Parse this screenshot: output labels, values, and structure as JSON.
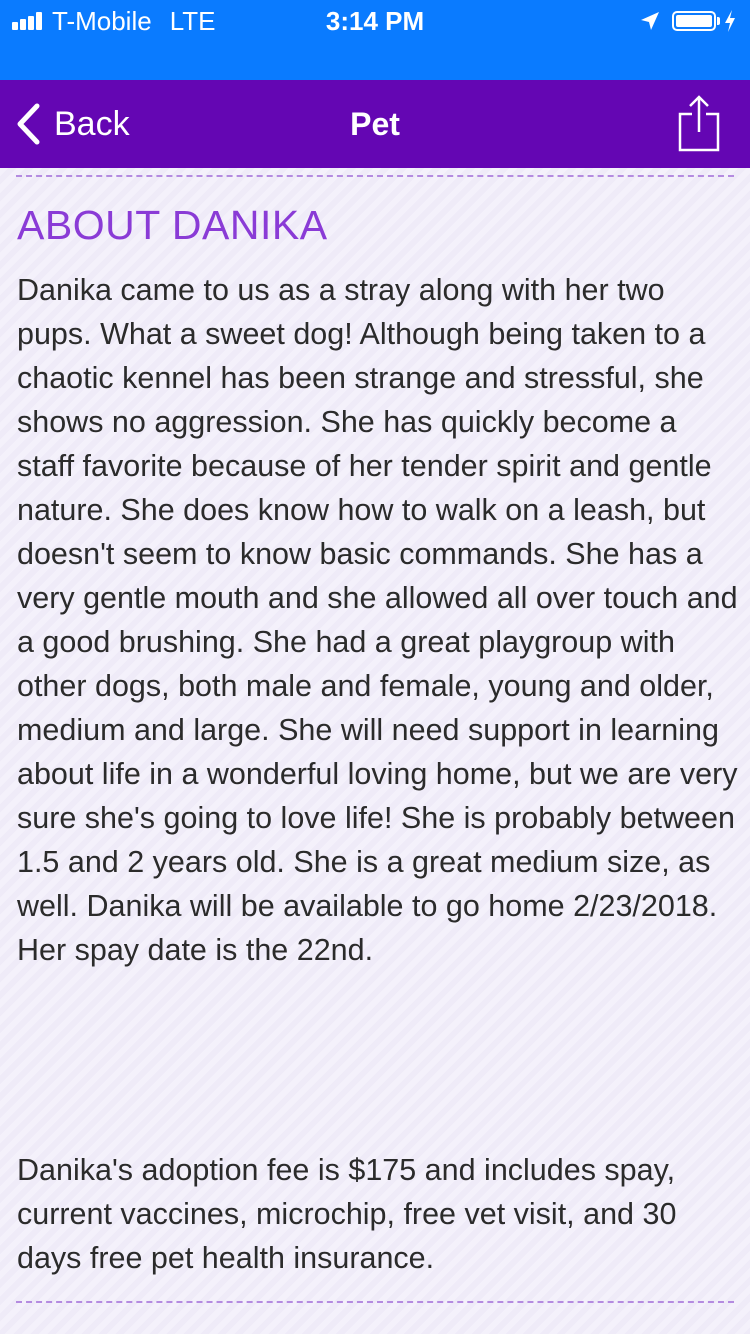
{
  "status_bar": {
    "carrier": "T-Mobile",
    "network": "LTE",
    "time": "3:14 PM",
    "signal_bars": 4,
    "battery_level": 1.0,
    "charging": true,
    "location_services": true
  },
  "nav_bar": {
    "back_label": "Back",
    "title": "Pet",
    "share_icon": "share-icon"
  },
  "pet": {
    "section_title": "ABOUT DANIKA",
    "description": "Danika came to us as a stray along with her two pups. What a sweet dog! Although being taken to a chaotic kennel has been strange and stressful, she shows no aggression. She has quickly become a staff favorite because of her tender spirit and gentle nature. She does know how to walk on a leash, but doesn't seem to know basic commands. She has a very gentle mouth and she allowed all over touch and a good brushing. She had a great playgroup with other dogs, both male and female, young and older, medium and large. She will need support in learning about life in a wonderful loving home, but we are very sure she's going to love life! She is probably between 1.5 and 2 years old. She is a great medium size, as well. Danika will be available to go home 2/23/2018. Her spay date is the 22nd.",
    "fee_text": "Danika's adoption fee is $175 and includes spay, current vaccines, microchip, free vet visit, and 30 days free pet health insurance."
  },
  "colors": {
    "status_bar_bg": "#0a7bff",
    "nav_bar_bg": "#6406b3",
    "section_title": "#8a3bd6",
    "divider": "#b48be0",
    "body_text": "#2b2b2b"
  }
}
